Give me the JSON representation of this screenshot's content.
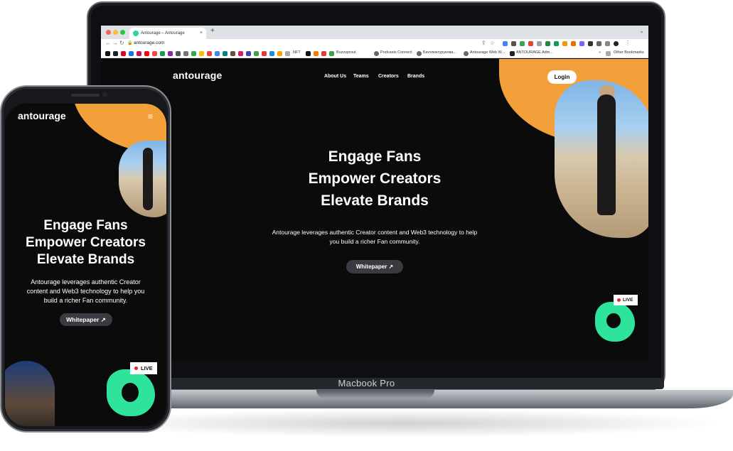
{
  "device_label": "Macbook Pro",
  "browser": {
    "tab_title": "Antourage – Antourage",
    "tab_close": "×",
    "new_tab": "+",
    "url": "antourage.com",
    "bookmarks": [
      "NFT",
      "Buzzsprout",
      "Podcasts Connect",
      "Бюллюкгурукова...",
      "Antourage Web W...",
      "ANTOURAGE Adm..."
    ],
    "other_bookmarks": "Other Bookmarks"
  },
  "site": {
    "logo": "antourage",
    "nav": [
      "About Us",
      "Teams",
      "Creators",
      "Brands"
    ],
    "login": "Login",
    "headline": [
      "Engage Fans",
      "Empower Creators",
      "Elevate Brands"
    ],
    "subtext_1": "Antourage leverages authentic Creator content and Web3 technology to help",
    "subtext_2": "you build a richer Fan community.",
    "whitepaper": "Whitepaper ↗",
    "live_badge": "LIVE"
  },
  "mobile": {
    "logo": "antourage",
    "menu_icon": "≡",
    "headline": [
      "Engage Fans",
      "Empower Creators",
      "Elevate Brands"
    ],
    "subtext": [
      "Antourage leverages authentic Creator",
      "content and Web3 technology to help you",
      "build a richer Fan community."
    ],
    "whitepaper": "Whitepaper ↗",
    "live_badge": "LIVE"
  },
  "colors": {
    "accent_orange": "#f4a03a",
    "accent_green": "#2ee39c",
    "background": "#0b0b0b"
  }
}
